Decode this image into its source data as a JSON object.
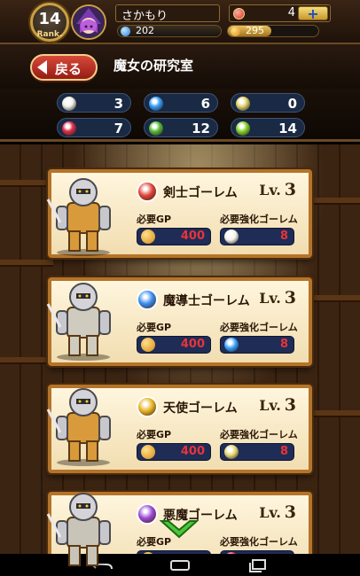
{
  "header": {
    "rank": "14",
    "rank_label": "Rank.",
    "player_name": "さかもり",
    "stamina_value": "202",
    "gp_value": "295",
    "gem_count": "4",
    "plus_label": "+"
  },
  "title_bar": {
    "back_label": "戻る",
    "title": "魔女の研究室"
  },
  "materials": [
    {
      "icon": "white-chick-icon",
      "color": "#f5f0e6",
      "value": "3"
    },
    {
      "icon": "blue-chick-icon",
      "color": "#3aa0ff",
      "value": "6"
    },
    {
      "icon": "gold-chick-icon",
      "color": "#e6d36a",
      "value": "0"
    },
    {
      "icon": "red-chick-icon",
      "color": "#e0304a",
      "value": "7"
    },
    {
      "icon": "green-chick-icon",
      "color": "#5cc03a",
      "value": "12"
    },
    {
      "icon": "lime-chick-icon",
      "color": "#8ad62a",
      "value": "14"
    }
  ],
  "labels": {
    "level_prefix": "Lv.",
    "required_gp": "必要GP",
    "required_golem": "必要強化ゴーレム"
  },
  "golems": [
    {
      "name": "剣士ゴーレム",
      "level": "3",
      "type_icon": "sword-type-icon",
      "type_color": "#e0443a",
      "gp": "400",
      "golem_count": "8",
      "req_icon_color": "#f5f0e6"
    },
    {
      "name": "魔導士ゴーレム",
      "level": "3",
      "type_icon": "magic-type-icon",
      "type_color": "#3a8ef0",
      "gp": "400",
      "golem_count": "8",
      "req_icon_color": "#3aa0ff"
    },
    {
      "name": "天使ゴーレム",
      "level": "3",
      "type_icon": "angel-type-icon",
      "type_color": "#e8b424",
      "gp": "400",
      "golem_count": "8",
      "req_icon_color": "#e6d36a"
    },
    {
      "name": "悪魔ゴーレム",
      "level": "3",
      "type_icon": "demon-type-icon",
      "type_color": "#9a4ad6",
      "gp": "",
      "golem_count": "",
      "req_icon_color": "#e0304a"
    }
  ]
}
